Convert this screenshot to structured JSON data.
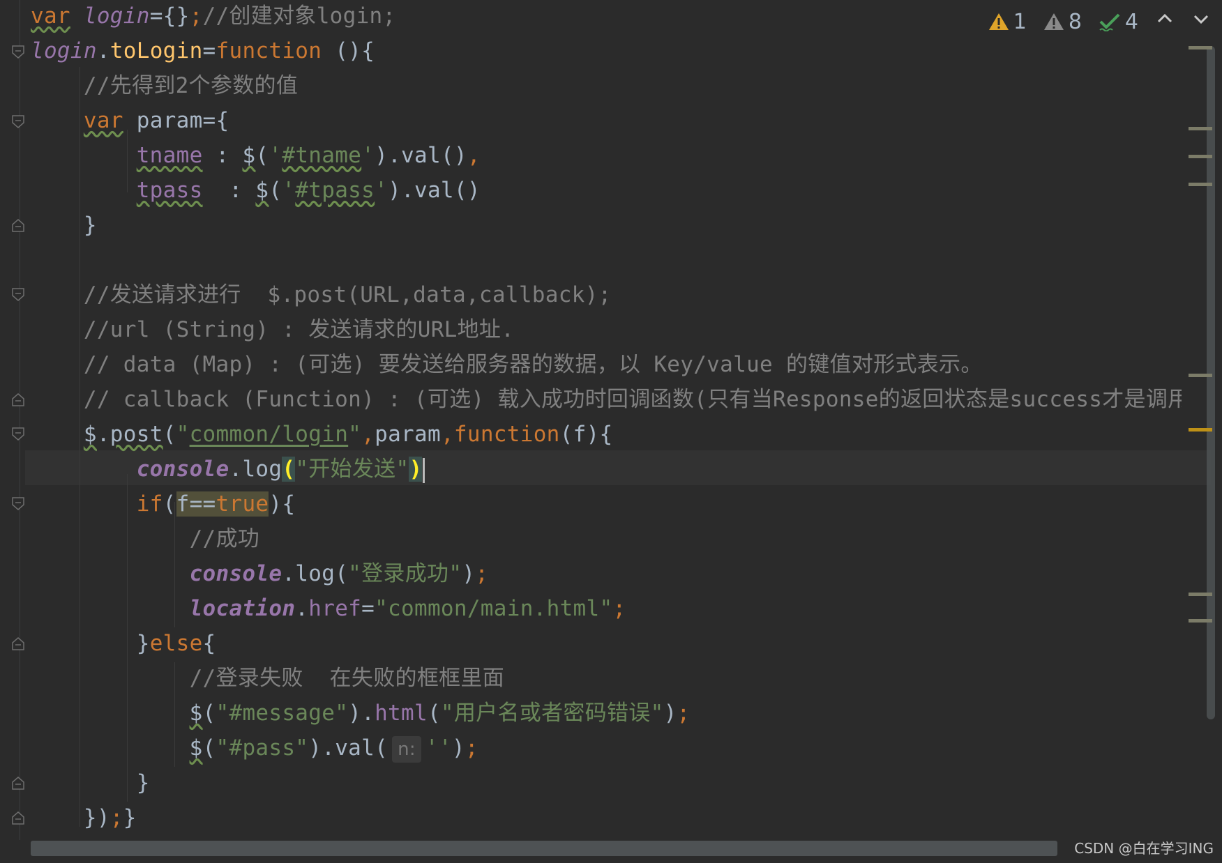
{
  "editor": {
    "lines": [
      {
        "segments": [
          {
            "t": "var",
            "c": "kw wavy"
          },
          {
            "t": " ",
            "c": "plain"
          },
          {
            "t": "login",
            "c": "var-it"
          },
          {
            "t": "={}",
            "c": "plain"
          },
          {
            "t": ";",
            "c": "kw"
          },
          {
            "t": "//创建对象login;",
            "c": "comment"
          }
        ]
      },
      {
        "segments": [
          {
            "t": "login",
            "c": "var-it"
          },
          {
            "t": ".",
            "c": "plain"
          },
          {
            "t": "toLogin",
            "c": "prop"
          },
          {
            "t": "=",
            "c": "plain"
          },
          {
            "t": "function",
            "c": "kw"
          },
          {
            "t": " (){",
            "c": "plain"
          }
        ]
      },
      {
        "segments": [
          {
            "t": "    //先得到2个参数的值",
            "c": "comment"
          }
        ]
      },
      {
        "segments": [
          {
            "t": "    ",
            "c": "plain"
          },
          {
            "t": "var",
            "c": "kw wavy"
          },
          {
            "t": " param={",
            "c": "plain"
          }
        ]
      },
      {
        "segments": [
          {
            "t": "        ",
            "c": "plain"
          },
          {
            "t": "tname",
            "c": "member wavy"
          },
          {
            "t": " : ",
            "c": "plain"
          },
          {
            "t": "$",
            "c": "plain wavy"
          },
          {
            "t": "(",
            "c": "plain"
          },
          {
            "t": "'",
            "c": "str"
          },
          {
            "t": "#tname",
            "c": "str wavy"
          },
          {
            "t": "'",
            "c": "str"
          },
          {
            "t": ").val()",
            "c": "plain"
          },
          {
            "t": ",",
            "c": "kw"
          }
        ]
      },
      {
        "segments": [
          {
            "t": "        ",
            "c": "plain"
          },
          {
            "t": "tpass",
            "c": "member wavy"
          },
          {
            "t": "  : ",
            "c": "plain"
          },
          {
            "t": "$",
            "c": "plain wavy"
          },
          {
            "t": "(",
            "c": "plain"
          },
          {
            "t": "'",
            "c": "str"
          },
          {
            "t": "#tpass",
            "c": "str wavy"
          },
          {
            "t": "'",
            "c": "str"
          },
          {
            "t": ").val()",
            "c": "plain"
          }
        ]
      },
      {
        "segments": [
          {
            "t": "    }",
            "c": "plain"
          }
        ]
      },
      {
        "segments": []
      },
      {
        "segments": [
          {
            "t": "    //发送请求进行  $.post(URL,data,callback);",
            "c": "comment"
          }
        ]
      },
      {
        "segments": [
          {
            "t": "    //url (String) : 发送请求的URL地址.",
            "c": "comment"
          }
        ]
      },
      {
        "segments": [
          {
            "t": "    // data (Map) : (可选) 要发送给服务器的数据，以 Key/value 的键值对形式表示。",
            "c": "comment"
          }
        ]
      },
      {
        "segments": [
          {
            "t": "    // callback (Function) : (可选) 载入成功时回调函数(只有当Response的返回状态是success才是调用该方法",
            "c": "comment"
          }
        ]
      },
      {
        "segments": [
          {
            "t": "    ",
            "c": "plain"
          },
          {
            "t": "$",
            "c": "plain wavy"
          },
          {
            "t": ".",
            "c": "plain"
          },
          {
            "t": "post",
            "c": "plain wavy"
          },
          {
            "t": "(",
            "c": "plain"
          },
          {
            "t": "\"",
            "c": "str"
          },
          {
            "t": "common/login",
            "c": "str url-link"
          },
          {
            "t": "\"",
            "c": "str"
          },
          {
            "t": ",",
            "c": "kw"
          },
          {
            "t": "param",
            "c": "plain"
          },
          {
            "t": ",",
            "c": "kw"
          },
          {
            "t": "function",
            "c": "kw"
          },
          {
            "t": "(f){",
            "c": "plain"
          }
        ]
      },
      {
        "segments": [
          {
            "t": "        ",
            "c": "plain"
          },
          {
            "t": "console",
            "c": "bold-it"
          },
          {
            "t": ".",
            "c": "plain"
          },
          {
            "t": "log",
            "c": "plain"
          },
          {
            "t": "(",
            "c": "yellow-paren match-bg"
          },
          {
            "t": "\"开始发送\"",
            "c": "str"
          },
          {
            "t": ")",
            "c": "yellow-paren match-bg"
          }
        ],
        "caret": true
      },
      {
        "segments": [
          {
            "t": "        ",
            "c": "plain"
          },
          {
            "t": "if",
            "c": "kw"
          },
          {
            "t": "(",
            "c": "plain"
          },
          {
            "t": "f==",
            "c": "plain hl-olive"
          },
          {
            "t": "true",
            "c": "kw hl-olive"
          },
          {
            "t": "){",
            "c": "plain"
          }
        ]
      },
      {
        "segments": [
          {
            "t": "            //成功",
            "c": "comment"
          }
        ]
      },
      {
        "segments": [
          {
            "t": "            ",
            "c": "plain"
          },
          {
            "t": "console",
            "c": "bold-it"
          },
          {
            "t": ".",
            "c": "plain"
          },
          {
            "t": "log",
            "c": "plain"
          },
          {
            "t": "(",
            "c": "plain"
          },
          {
            "t": "\"登录成功\"",
            "c": "str"
          },
          {
            "t": ")",
            "c": "plain"
          },
          {
            "t": ";",
            "c": "kw"
          }
        ]
      },
      {
        "segments": [
          {
            "t": "            ",
            "c": "plain"
          },
          {
            "t": "location",
            "c": "bold-it"
          },
          {
            "t": ".",
            "c": "plain"
          },
          {
            "t": "href",
            "c": "member"
          },
          {
            "t": "=",
            "c": "plain"
          },
          {
            "t": "\"common/main.html\"",
            "c": "str"
          },
          {
            "t": ";",
            "c": "kw"
          }
        ]
      },
      {
        "segments": [
          {
            "t": "        }",
            "c": "plain"
          },
          {
            "t": "else",
            "c": "kw"
          },
          {
            "t": "{",
            "c": "plain"
          }
        ]
      },
      {
        "segments": [
          {
            "t": "            //登录失败  在失败的框框里面",
            "c": "comment"
          }
        ]
      },
      {
        "segments": [
          {
            "t": "            ",
            "c": "plain"
          },
          {
            "t": "$",
            "c": "plain wavy"
          },
          {
            "t": "(",
            "c": "plain"
          },
          {
            "t": "\"#message\"",
            "c": "str"
          },
          {
            "t": ").",
            "c": "plain"
          },
          {
            "t": "html",
            "c": "member"
          },
          {
            "t": "(",
            "c": "plain"
          },
          {
            "t": "\"用户名或者密码错误\"",
            "c": "str"
          },
          {
            "t": ")",
            "c": "plain"
          },
          {
            "t": ";",
            "c": "kw"
          }
        ]
      },
      {
        "segments": [
          {
            "t": "            ",
            "c": "plain"
          },
          {
            "t": "$",
            "c": "plain wavy"
          },
          {
            "t": "(",
            "c": "plain"
          },
          {
            "t": "\"#pass\"",
            "c": "str"
          },
          {
            "t": ").val(",
            "c": "plain"
          },
          {
            "hint": "n:"
          },
          {
            "t": "''",
            "c": "str"
          },
          {
            "t": ")",
            "c": "plain"
          },
          {
            "t": ";",
            "c": "kw"
          }
        ]
      },
      {
        "segments": [
          {
            "t": "        }",
            "c": "plain"
          }
        ]
      },
      {
        "segments": [
          {
            "t": "    })",
            "c": "plain"
          },
          {
            "t": ";",
            "c": "kw"
          },
          {
            "t": "}",
            "c": "plain"
          }
        ]
      }
    ]
  },
  "inspections": {
    "errors_count": "1",
    "warnings_count": "8",
    "typos_count": "4"
  },
  "watermark": "CSDN @白在学习ING",
  "colors": {
    "background": "#2b2b2b",
    "keyword": "#cc7832",
    "string": "#6a8759",
    "comment": "#808080",
    "property": "#ffc66d",
    "member": "#9876aa",
    "warning": "#be9117"
  },
  "icons": {
    "error": "warning-triangle-icon",
    "warning": "warning-triangle-grey-icon",
    "typo": "check-icon",
    "prev": "chevron-up-icon",
    "next": "chevron-down-icon",
    "fold": "fold-icon"
  }
}
